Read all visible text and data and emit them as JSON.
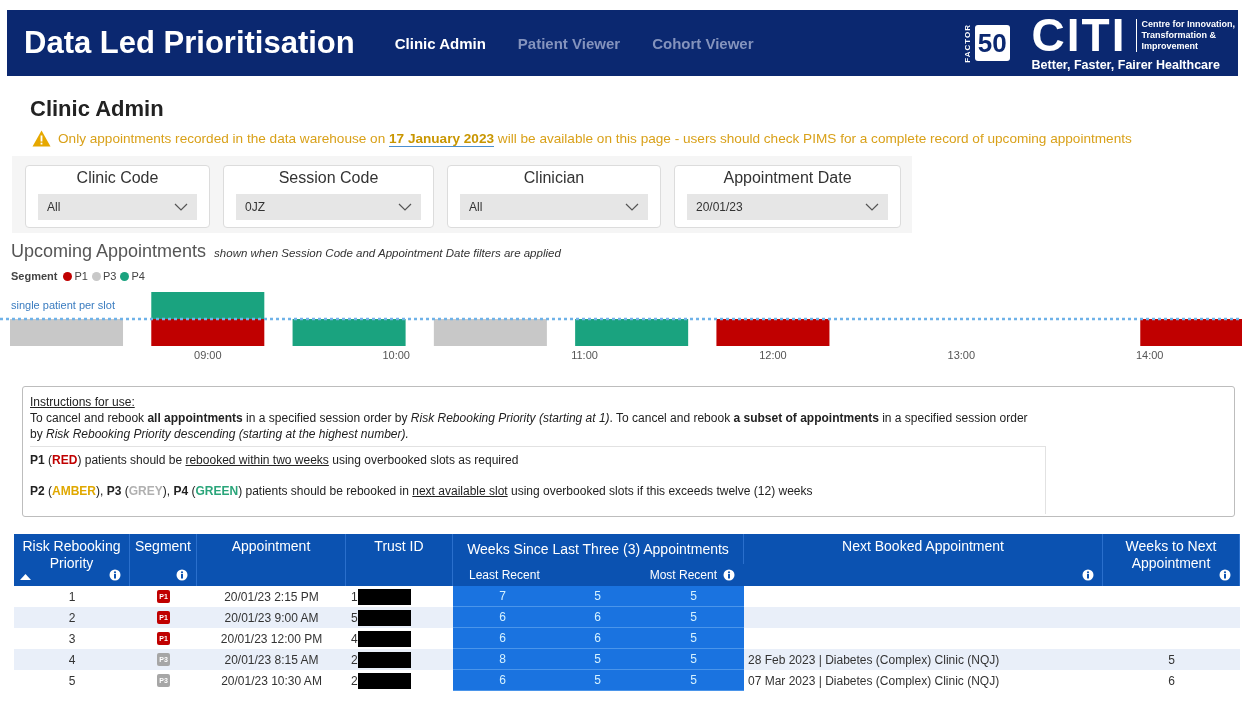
{
  "header": {
    "title": "Data Led Prioritisation",
    "tabs": [
      {
        "label": "Clinic Admin",
        "selected": true
      },
      {
        "label": "Patient Viewer",
        "selected": false
      },
      {
        "label": "Cohort Viewer",
        "selected": false
      }
    ],
    "logo": {
      "factor_label": "FACTOR",
      "factor_number": "50",
      "name": "CITI",
      "tagline_lines": [
        "Centre for Innovation,",
        "Transformation &",
        "Improvement"
      ],
      "slogan": "Better, Faster, Fairer Healthcare"
    }
  },
  "page_title": "Clinic Admin",
  "warning": {
    "before": "Only appointments recorded in the data warehouse on",
    "date": "17 January 2023",
    "after": "will be available on this page - users should check PIMS for a complete record of upcoming appointments"
  },
  "filters": [
    {
      "label": "Clinic Code",
      "value": "All"
    },
    {
      "label": "Session Code",
      "value": "0JZ"
    },
    {
      "label": "Clinician",
      "value": "All"
    },
    {
      "label": "Appointment Date",
      "value": "20/01/23"
    }
  ],
  "upcoming": {
    "title": "Upcoming Appointments",
    "note": "shown when Session Code and Appointment Date filters are applied",
    "legend_title": "Segment",
    "legend": [
      {
        "label": "P1",
        "color": "#c00000"
      },
      {
        "label": "P3",
        "color": "#c8c8c8"
      },
      {
        "label": "P4",
        "color": "#1aa37f"
      }
    ],
    "reference_label": "single patient per slot",
    "axis_labels": [
      "09:00",
      "10:00",
      "11:00",
      "12:00",
      "13:00",
      "14:00"
    ]
  },
  "instructions": {
    "title": "Instructions for use:",
    "text": "To cancel and rebook **all appointments** in a specified session order by *Risk Rebooking Priority (starting at 1)*. To cancel and rebook **a subset of appointments** in a specified session order by *Risk Rebooking Priority descending (starting at the highest number).*",
    "rules": [
      [
        {
          "kind": "bold",
          "text": "P1"
        },
        {
          "kind": "plain",
          "text": " ("
        },
        {
          "kind": "colored",
          "text": "RED",
          "color": "#c00000"
        },
        {
          "kind": "plain",
          "text": ") patients should be "
        },
        {
          "kind": "underline",
          "text": "rebooked within two weeks"
        },
        {
          "kind": "plain",
          "text": " using overbooked slots as required"
        }
      ],
      [
        {
          "kind": "bold",
          "text": "P2"
        },
        {
          "kind": "plain",
          "text": " ("
        },
        {
          "kind": "colored",
          "text": "AMBER",
          "color": "#e0a800"
        },
        {
          "kind": "plain",
          "text": "), "
        },
        {
          "kind": "bold",
          "text": "P3"
        },
        {
          "kind": "plain",
          "text": " ("
        },
        {
          "kind": "colored",
          "text": "GREY",
          "color": "#b0b0b0"
        },
        {
          "kind": "plain",
          "text": "), "
        },
        {
          "kind": "bold",
          "text": "P4"
        },
        {
          "kind": "plain",
          "text": " ("
        },
        {
          "kind": "colored",
          "text": "GREEN",
          "color": "#2aa57a"
        },
        {
          "kind": "plain",
          "text": ") patients should be rebooked in "
        },
        {
          "kind": "underline",
          "text": "next available slot"
        },
        {
          "kind": "plain",
          "text": " using overbooked slots if this exceeds twelve (12) weeks"
        }
      ]
    ]
  },
  "table": {
    "columns": [
      {
        "label": "Risk Rebooking Priority",
        "sorted": true,
        "info": true
      },
      {
        "label": "Segment",
        "sorted": false,
        "info": true
      },
      {
        "label": "Appointment",
        "sorted": false,
        "info": false
      },
      {
        "label": "Trust ID",
        "sorted": false,
        "info": false
      },
      {
        "label": "Weeks Since Last Three (3) Appointments",
        "sorted": false,
        "info": true,
        "sub_labels": [
          "Least Recent",
          "Most Recent"
        ]
      },
      {
        "label": "Next Booked Appointment",
        "sorted": false,
        "info": true
      },
      {
        "label": "Weeks to Next Appointment",
        "sorted": false,
        "info": true
      }
    ],
    "rows": [
      {
        "priority": "1",
        "segment": {
          "label": "P1",
          "color": "#c00000"
        },
        "appointment": "20/01/23 2:15 PM",
        "trust_id": "1",
        "redacted": true,
        "weeks_since": [
          "7",
          "5",
          "5"
        ]
      },
      {
        "priority": "2",
        "segment": {
          "label": "P1",
          "color": "#c00000"
        },
        "appointment": "20/01/23 9:00 AM",
        "trust_id": "5",
        "redacted": true,
        "weeks_since": [
          "6",
          "6",
          "5"
        ]
      },
      {
        "priority": "3",
        "segment": {
          "label": "P1",
          "color": "#c00000"
        },
        "appointment": "20/01/23 12:00 PM",
        "trust_id": "4",
        "redacted": true,
        "weeks_since": [
          "6",
          "6",
          "5"
        ]
      },
      {
        "priority": "4",
        "segment": {
          "label": "P3",
          "color": "#a6a6a6"
        },
        "appointment": "20/01/23 8:15 AM",
        "trust_id": "2",
        "redacted": true,
        "weeks_since": [
          "8",
          "5",
          "5"
        ],
        "next_booked": "28 Feb 2023 | Diabetes (Complex) Clinic (NQJ)",
        "weeks_to_next": "5"
      },
      {
        "priority": "5",
        "segment": {
          "label": "P3",
          "color": "#a6a6a6"
        },
        "appointment": "20/01/23 10:30 AM",
        "trust_id": "2",
        "redacted": true,
        "weeks_since": [
          "6",
          "5",
          "5"
        ],
        "next_booked": "07 Mar 2023 | Diabetes (Complex) Clinic (NQJ)",
        "weeks_to_next": "6"
      }
    ]
  }
}
